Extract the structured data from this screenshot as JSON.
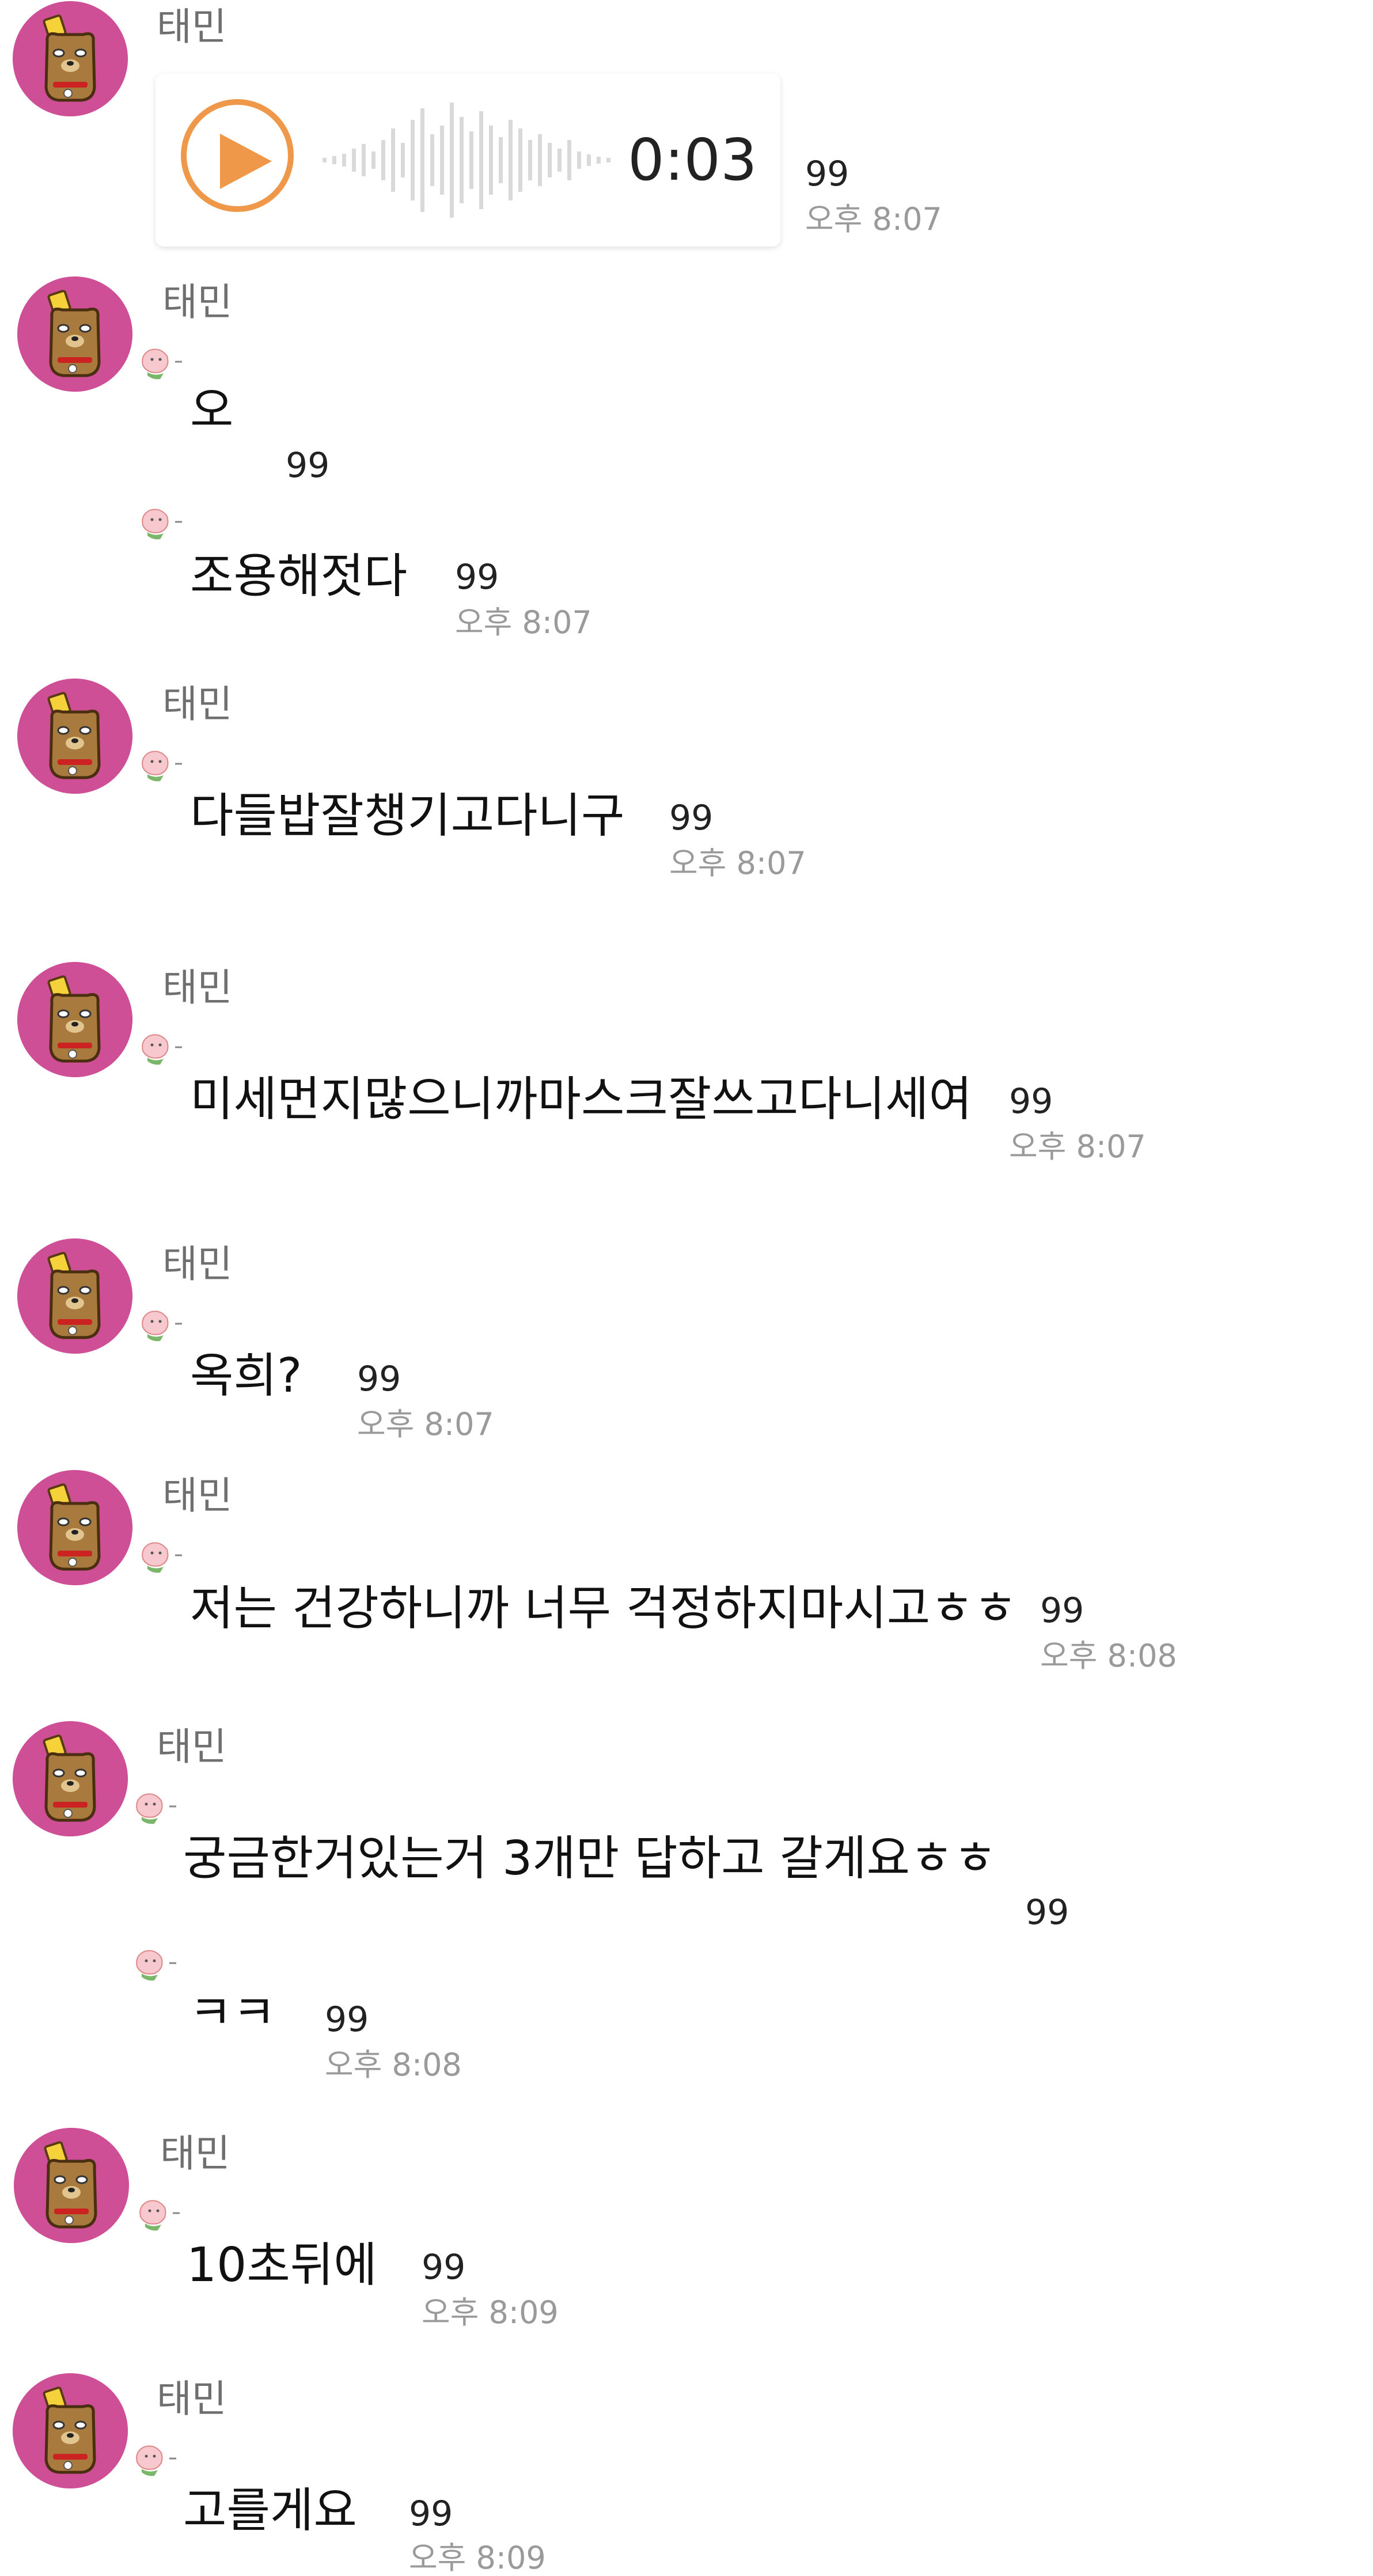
{
  "sender": "태민",
  "voice_message": {
    "duration": "0:03",
    "count": "99",
    "time": "오후 8:07"
  },
  "messages": [
    {
      "text": "오",
      "count": "99",
      "time": ""
    },
    {
      "text": "조용해젓다",
      "count": "99",
      "time": "오후 8:07"
    },
    {
      "text": "다들밥잘챙기고다니구",
      "count": "99",
      "time": "오후 8:07"
    },
    {
      "text": "미세먼지많으니까마스크잘쓰고다니세여",
      "count": "99",
      "time": "오후 8:07"
    },
    {
      "text": "옥희?",
      "count": "99",
      "time": "오후 8:07"
    },
    {
      "text": "저는 건강하니까 너무 걱정하지마시고ㅎㅎ",
      "count": "99",
      "time": "오후 8:08"
    },
    {
      "text": "궁금한거있는거 3개만 답하고 갈게요ㅎㅎ",
      "count": "99",
      "time": ""
    },
    {
      "text": "ㅋㅋ",
      "count": "99",
      "time": "오후 8:08"
    },
    {
      "text": "10초뒤에",
      "count": "99",
      "time": "오후 8:09"
    },
    {
      "text": "고를게요",
      "count": "99",
      "time": "오후 8:09"
    }
  ],
  "colors": {
    "avatar_bg": "#cf4f97",
    "play_accent": "#f0984a",
    "name_text": "#6f6f6f",
    "time_text": "#9a9a9a"
  },
  "icons": {
    "avatar": "bear-character-avatar",
    "emote": "peach-emoticon-icon",
    "play": "play-icon"
  }
}
